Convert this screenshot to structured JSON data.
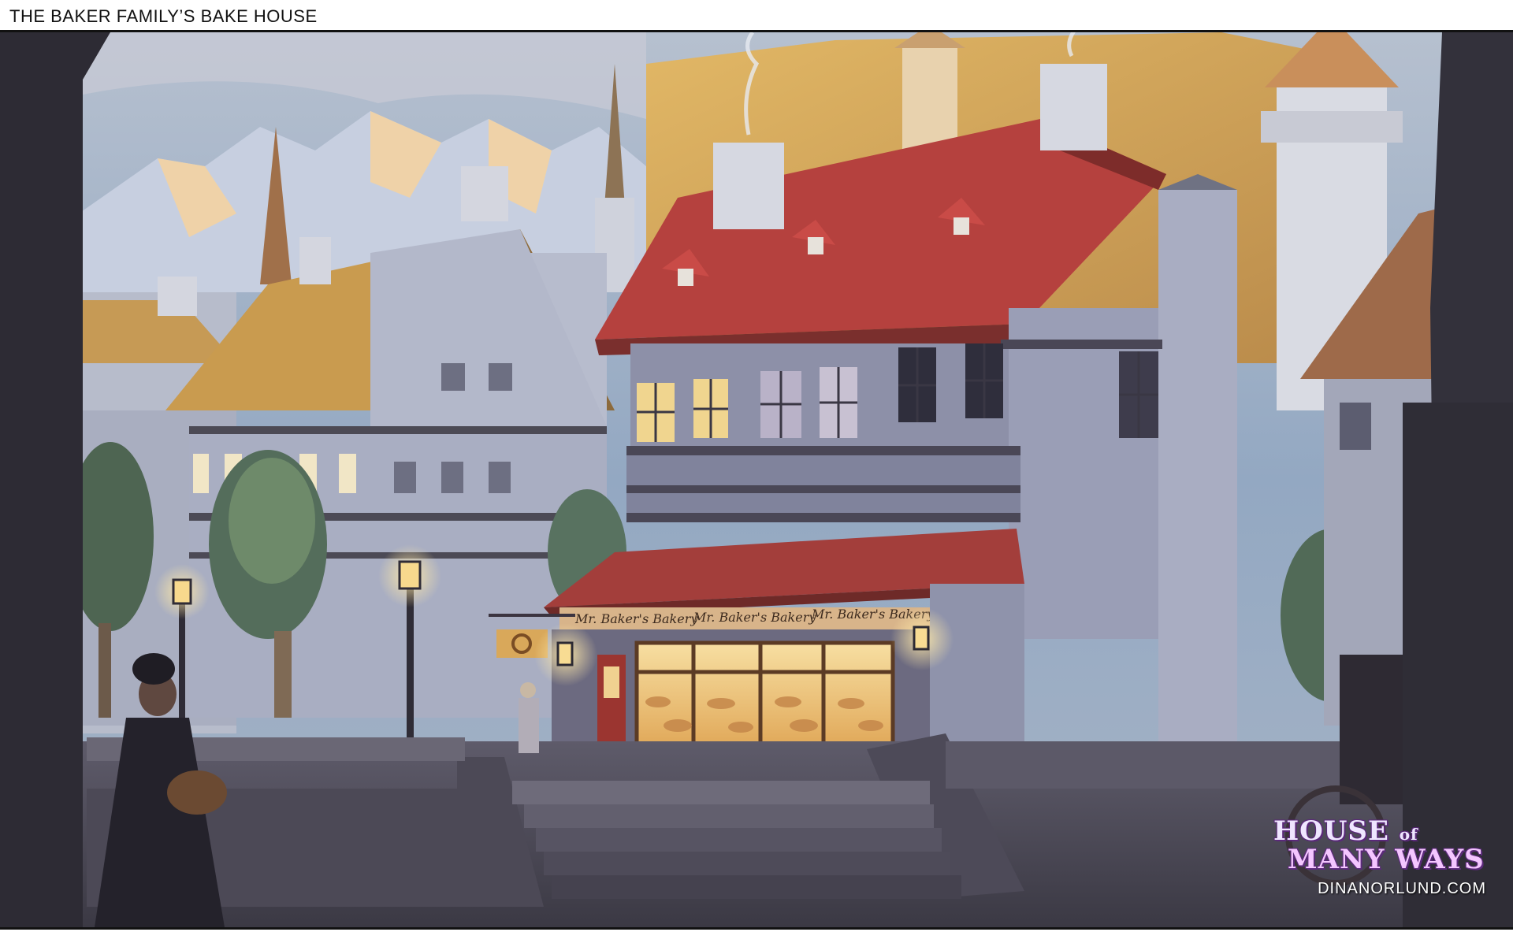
{
  "header": {
    "title": "THE BAKER FAMILY’S BAKE HOUSE"
  },
  "shop": {
    "sign_texts": [
      "Mr. Baker's Bakery",
      "Mr. Baker's Bakery",
      "Mr. Baker's Bakery"
    ]
  },
  "branding": {
    "logo_line1": "HOUSE",
    "logo_of": "of",
    "logo_line2": "MANY WAYS",
    "website": "DINANORLUND.COM"
  },
  "colors": {
    "sky": "#8ea4bd",
    "roof_red": "#b5413e",
    "roof_ochre": "#c99b4f",
    "wall_stone": "#8f95ad",
    "window_glow": "#f3d28e",
    "shadow": "#2c2a33"
  }
}
